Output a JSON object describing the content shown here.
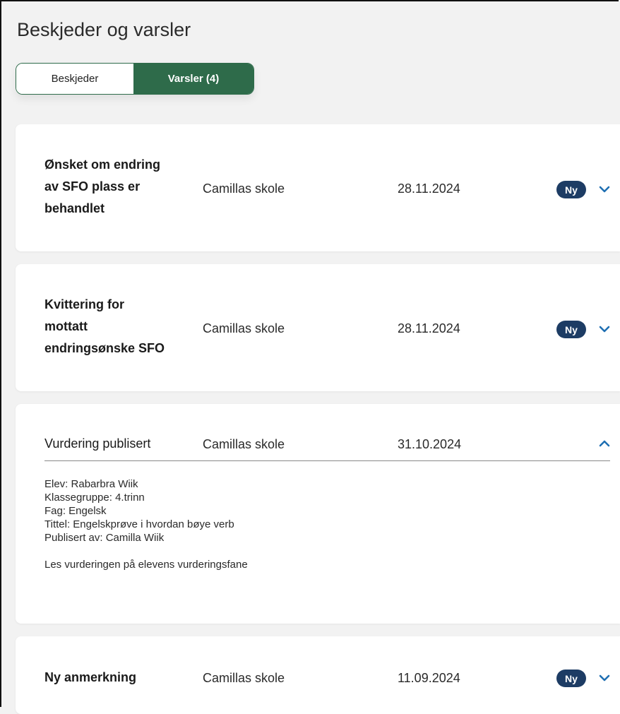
{
  "page": {
    "title": "Beskjeder og varsler"
  },
  "tabs": [
    {
      "label": "Beskjeder",
      "active": false
    },
    {
      "label": "Varsler (4)",
      "active": true
    }
  ],
  "colors": {
    "accent_green": "#2e6b4a",
    "badge_navy": "#1d3c64",
    "chevron_blue": "#1f6fb2"
  },
  "notifications": [
    {
      "title": "Ønsket om endring av SFO plass er behandlet",
      "title_lines": [
        "Ønsket om endring",
        "av SFO plass er",
        "behandlet"
      ],
      "sender": "Camillas skole",
      "date": "28.11.2024",
      "badge": "Ny",
      "expanded": false,
      "chevron_icon": "chevron-down-icon"
    },
    {
      "title": "Kvittering for mottatt endringsønske SFO",
      "title_lines": [
        "Kvittering for",
        "mottatt",
        "endringsønske SFO"
      ],
      "sender": "Camillas skole",
      "date": "28.11.2024",
      "badge": "Ny",
      "expanded": false,
      "chevron_icon": "chevron-down-icon"
    },
    {
      "title": "Vurdering publisert",
      "sender": "Camillas skole",
      "date": "31.10.2024",
      "expanded": true,
      "chevron_icon": "chevron-up-icon",
      "details": [
        "Elev: Rabarbra Wiik",
        "Klassegruppe: 4.trinn",
        "Fag: Engelsk",
        "Tittel: Engelskprøve i hvordan bøye verb",
        "Publisert av: Camilla Wiik"
      ],
      "footer_text": "Les vurderingen på elevens vurderingsfane"
    },
    {
      "title": "Ny anmerkning",
      "sender": "Camillas skole",
      "date": "11.09.2024",
      "badge": "Ny",
      "expanded": false,
      "chevron_icon": "chevron-down-icon"
    }
  ]
}
